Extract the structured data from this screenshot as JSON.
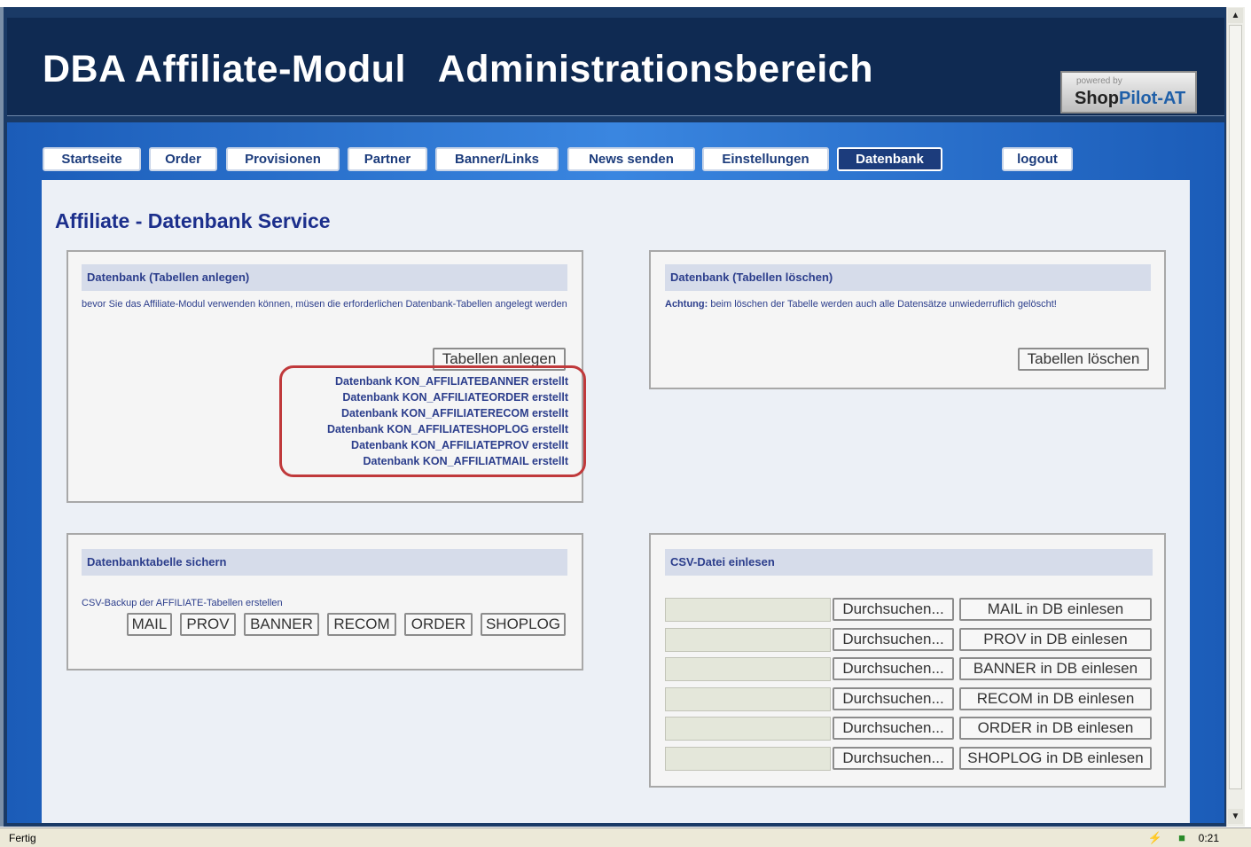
{
  "header": {
    "title": "DBA Affiliate-Modul   Administrationsbereich",
    "powered_by": "powered by",
    "brand_shop": "Shop",
    "brand_pilot": "Pilot-AT"
  },
  "nav": [
    {
      "label": "Startseite",
      "active": false
    },
    {
      "label": "Order",
      "active": false
    },
    {
      "label": "Provisionen",
      "active": false
    },
    {
      "label": "Partner",
      "active": false
    },
    {
      "label": "Banner/Links",
      "active": false
    },
    {
      "label": "News senden",
      "active": false
    },
    {
      "label": "Einstellungen",
      "active": false
    },
    {
      "label": "Datenbank",
      "active": true
    },
    {
      "label": "logout",
      "active": false
    }
  ],
  "page_title": "Affiliate - Datenbank Service",
  "create_panel": {
    "title": "Datenbank (Tabellen anlegen)",
    "text": "bevor Sie das Affiliate-Modul verwenden können, müsen die erforderlichen Datenbank-Tabellen angelegt werden",
    "button": "Tabellen anlegen",
    "messages": [
      "Datenbank KON_AFFILIATEBANNER erstellt",
      "Datenbank KON_AFFILIATEORDER erstellt",
      "Datenbank KON_AFFILIATERECOM erstellt",
      "Datenbank KON_AFFILIATESHOPLOG erstellt",
      "Datenbank KON_AFFILIATEPROV erstellt",
      "Datenbank KON_AFFILIATMAIL erstellt"
    ]
  },
  "delete_panel": {
    "title": "Datenbank (Tabellen löschen)",
    "warning_label": "Achtung:",
    "warning_text": " beim löschen der Tabelle werden auch alle Datensätze unwiederruflich gelöscht!",
    "button": "Tabellen löschen"
  },
  "backup_panel": {
    "title": "Datenbanktabelle sichern",
    "text": "CSV-Backup der AFFILIATE-Tabellen erstellen",
    "buttons": [
      "MAIL",
      "PROV",
      "BANNER",
      "RECOM",
      "ORDER",
      "SHOPLOG"
    ]
  },
  "csv_panel": {
    "title": "CSV-Datei einlesen",
    "browse_label": "Durchsuchen...",
    "rows": [
      {
        "import_label": "MAIL in DB einlesen"
      },
      {
        "import_label": "PROV in DB einlesen"
      },
      {
        "import_label": "BANNER in DB einlesen"
      },
      {
        "import_label": "RECOM in DB einlesen"
      },
      {
        "import_label": "ORDER in DB einlesen"
      },
      {
        "import_label": "SHOPLOG in DB einlesen"
      }
    ]
  },
  "statusbar": {
    "status": "Fertig",
    "time": "0:21"
  }
}
